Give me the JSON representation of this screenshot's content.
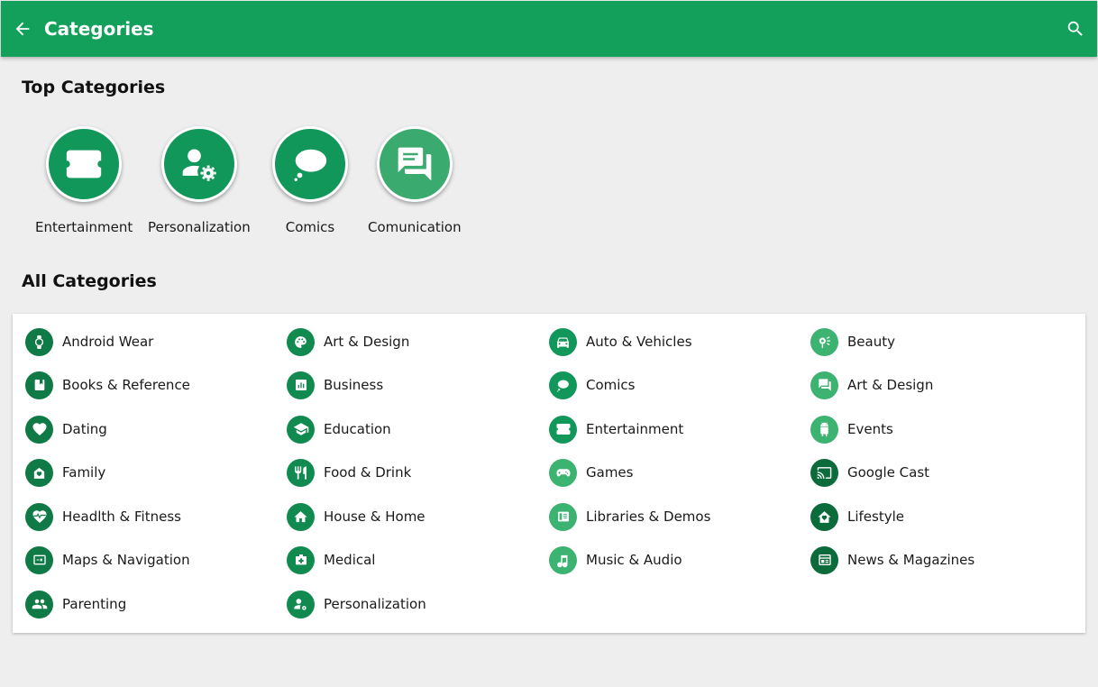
{
  "appbar": {
    "title": "Categories",
    "back_icon": "arrow-back-icon",
    "search_icon": "search-icon",
    "color": "#12a05a"
  },
  "top_section": {
    "title": "Top Categories",
    "items": [
      {
        "label": "Entertainment",
        "icon": "ticket-icon"
      },
      {
        "label": "Personalization",
        "icon": "person-settings-icon"
      },
      {
        "label": "Comics",
        "icon": "thought-bubble-icon"
      },
      {
        "label": "Comunication",
        "icon": "forum-icon"
      }
    ]
  },
  "all_section": {
    "title": "All Categories",
    "items": [
      {
        "label": "Android Wear",
        "icon": "watch-icon",
        "color": "#0f7a45"
      },
      {
        "label": "Art & Design",
        "icon": "palette-icon",
        "color": "#118a4f"
      },
      {
        "label": "Auto & Vehicles",
        "icon": "car-icon",
        "color": "#12975a"
      },
      {
        "label": "Beauty",
        "icon": "beauty-icon",
        "color": "#3cb371"
      },
      {
        "label": "Books & Reference",
        "icon": "book-icon",
        "color": "#0f7a45"
      },
      {
        "label": "Business",
        "icon": "chart-icon",
        "color": "#118a4f"
      },
      {
        "label": "Comics",
        "icon": "chat-bubble-icon",
        "color": "#12975a"
      },
      {
        "label": "Art & Design",
        "icon": "forum-icon",
        "color": "#3cb371"
      },
      {
        "label": "Dating",
        "icon": "heart-icon",
        "color": "#0f7a45"
      },
      {
        "label": "Education",
        "icon": "school-icon",
        "color": "#118a4f"
      },
      {
        "label": "Entertainment",
        "icon": "ticket-icon",
        "color": "#12975a"
      },
      {
        "label": "Events",
        "icon": "android-icon",
        "color": "#3cb371"
      },
      {
        "label": "Family",
        "icon": "family-icon",
        "color": "#0f7a45"
      },
      {
        "label": "Food & Drink",
        "icon": "restaurant-icon",
        "color": "#118a4f"
      },
      {
        "label": "Games",
        "icon": "gamepad-icon",
        "color": "#3cb371"
      },
      {
        "label": "Google Cast",
        "icon": "cast-icon",
        "color": "#0b6b3a"
      },
      {
        "label": "Headlth & Fitness",
        "icon": "heartbeat-icon",
        "color": "#0f7a45"
      },
      {
        "label": "House & Home",
        "icon": "home-icon",
        "color": "#118a4f"
      },
      {
        "label": "Libraries & Demos",
        "icon": "library-icon",
        "color": "#3cb371"
      },
      {
        "label": "Lifestyle",
        "icon": "lifestyle-home-icon",
        "color": "#0b6b3a"
      },
      {
        "label": "Maps & Navigation",
        "icon": "map-icon",
        "color": "#0f7a45"
      },
      {
        "label": "Medical",
        "icon": "medical-icon",
        "color": "#118a4f"
      },
      {
        "label": "Music & Audio",
        "icon": "music-note-icon",
        "color": "#3cb371"
      },
      {
        "label": "News & Magazines",
        "icon": "newspaper-icon",
        "color": "#0b6b3a"
      },
      {
        "label": "Parenting",
        "icon": "people-icon",
        "color": "#0f7a45"
      },
      {
        "label": "Personalization",
        "icon": "person-settings-icon",
        "color": "#118a4f"
      }
    ]
  }
}
